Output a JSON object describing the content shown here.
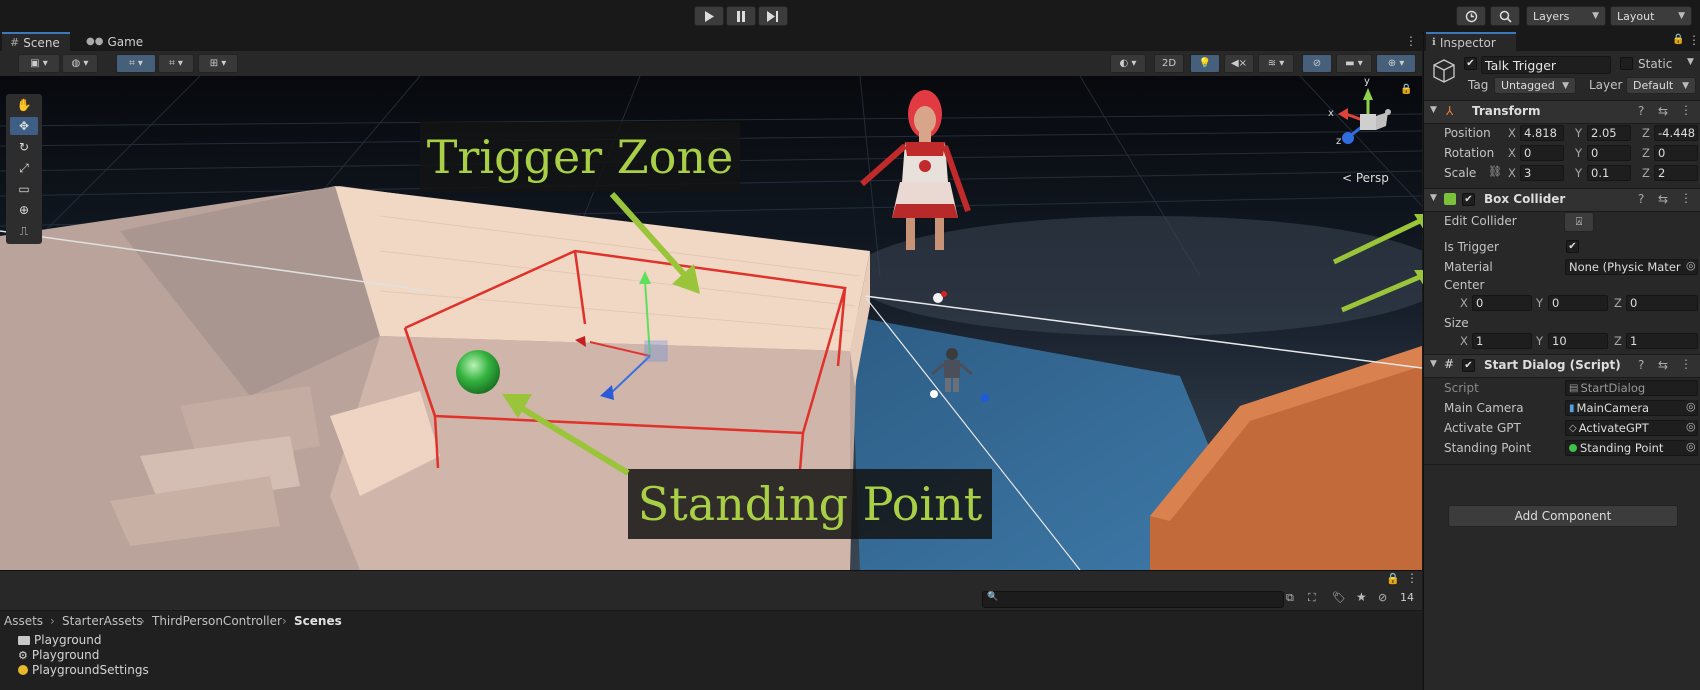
{
  "toolbar": {
    "layers_label": "Layers",
    "layout_label": "Layout",
    "play_icon": "play-icon",
    "pause_icon": "pause-icon",
    "step_icon": "step-icon"
  },
  "scene_tabs": [
    {
      "label": "Scene"
    },
    {
      "label": "Game"
    }
  ],
  "scene_toolbar": {
    "mode_2d": "2D"
  },
  "gizmo": {
    "x": "x",
    "y": "y",
    "z": "z",
    "persp_label": "< Persp"
  },
  "annotations": {
    "trigger_zone": "Trigger Zone",
    "standing_point": "Standing Point",
    "color": "#a8cf45"
  },
  "inspector": {
    "tab_label": "Inspector",
    "object_name": "Talk Trigger",
    "static_label": "Static",
    "tag_label": "Tag",
    "tag_value": "Untagged",
    "layer_label": "Layer",
    "layer_value": "Default",
    "transform": {
      "title": "Transform",
      "position_label": "Position",
      "rotation_label": "Rotation",
      "scale_label": "Scale",
      "position": {
        "x": "4.818",
        "y": "2.05",
        "z": "-4.448"
      },
      "rotation": {
        "x": "0",
        "y": "0",
        "z": "0"
      },
      "scale": {
        "x": "3",
        "y": "0.1",
        "z": "2"
      }
    },
    "box_collider": {
      "title": "Box Collider",
      "edit_collider_label": "Edit Collider",
      "is_trigger_label": "Is Trigger",
      "is_trigger": true,
      "material_label": "Material",
      "material_value": "None (Physic Mater",
      "center_label": "Center",
      "center": {
        "x": "0",
        "y": "0",
        "z": "0"
      },
      "size_label": "Size",
      "size": {
        "x": "1",
        "y": "10",
        "z": "1"
      }
    },
    "start_dialog": {
      "title": "Start Dialog (Script)",
      "script_label": "Script",
      "script_value": "StartDialog",
      "main_camera_label": "Main Camera",
      "main_camera_value": "MainCamera",
      "activate_gpt_label": "Activate GPT",
      "activate_gpt_value": "ActivateGPT",
      "standing_point_label": "Standing Point",
      "standing_point_value": "Standing Point"
    },
    "add_component_label": "Add Component",
    "axis": {
      "x": "X",
      "y": "Y",
      "z": "Z"
    }
  },
  "project": {
    "hidden_count": "14",
    "breadcrumb": [
      "Assets",
      "StarterAssets",
      "ThirdPersonController",
      "Scenes"
    ],
    "assets": [
      {
        "name": "Playground",
        "icon": "folder-icon"
      },
      {
        "name": "Playground",
        "icon": "unity-scene-icon"
      },
      {
        "name": "PlaygroundSettings",
        "icon": "lighting-settings-icon"
      }
    ]
  }
}
